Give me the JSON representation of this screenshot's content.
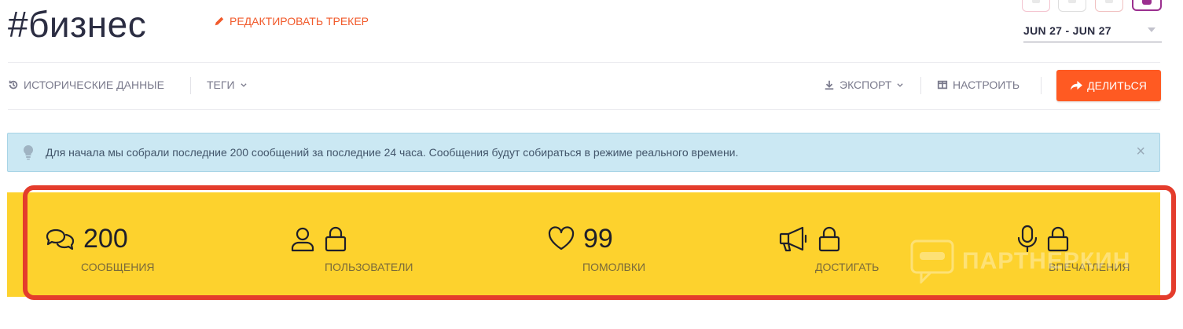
{
  "header": {
    "title": "#бизнес",
    "edit_label": "РЕДАКТИРОВАТЬ ТРЕКЕР",
    "date_range": "JUN 27 - JUN 27"
  },
  "toolbar": {
    "history_label": "ИСТОРИЧЕСКИЕ ДАННЫЕ",
    "tags_label": "ТЕГИ",
    "export_label": "ЭКСПОРТ",
    "configure_label": "НАСТРОИТЬ",
    "share_label": "ДЕЛИТЬСЯ"
  },
  "banner": {
    "text": "Для начала мы собрали последние 200 сообщений за последние 24 часа. Сообщения будут собираться в режиме реального времени.",
    "close": "×"
  },
  "stats": {
    "messages": {
      "value": "200",
      "label": "СООБЩЕНИЯ",
      "icon": "chat-bubbles-icon"
    },
    "users": {
      "label": "ПОЛЬЗОВАТЕЛИ",
      "icon": "user-icon",
      "locked": true
    },
    "likes": {
      "value": "99",
      "label": "ПОМОЛВКИ",
      "icon": "heart-icon"
    },
    "reach": {
      "label": "ДОСТИГАТЬ",
      "icon": "megaphone-icon",
      "locked": true
    },
    "impressions": {
      "label": "ВПЕЧАТЛЕНИЯ",
      "icon": "microphone-icon",
      "locked": true
    }
  },
  "watermark": {
    "text": "ПАРТНЕРКИН"
  },
  "colors": {
    "accent": "#f15a2b",
    "share_button": "#ff5a22",
    "stats_background": "#fdd22d",
    "highlight_border": "#e43c2c",
    "banner_background": "#cbe8f3"
  }
}
